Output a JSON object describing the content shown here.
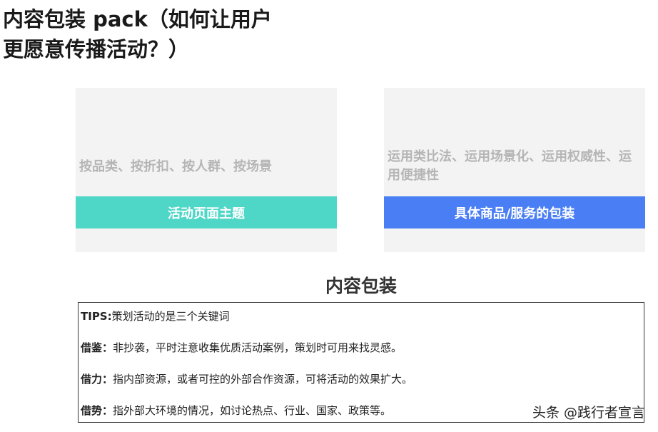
{
  "heading": {
    "line1": "内容包装 pack（如何让用户",
    "line2": "更愿意传播活动？）"
  },
  "cards": [
    {
      "description": "按品类、按折扣、按人群、按场景",
      "band_label": "活动页面主题",
      "band_color": "#4ed6c6"
    },
    {
      "description": "运用类比法、运用场景化、运用权威性、运用便捷性",
      "band_label": "具体商品/服务的包装",
      "band_color": "#4a7ef4"
    }
  ],
  "section_title": "内容包装",
  "tips": [
    {
      "label": "TIPS:",
      "text": "策划活动的是三个关键词"
    },
    {
      "label": "借鉴：",
      "text": "非抄袭，平时注意收集优质活动案例，策划时可用来找灵感。"
    },
    {
      "label": "借力：",
      "text": "指内部资源，或者可控的外部合作资源，可将活动的效果扩大。"
    },
    {
      "label": "借势：",
      "text": "指外部大环境的情况，如讨论热点、行业、国家、政策等。"
    }
  ],
  "watermark": "头条 @践行者宣言"
}
